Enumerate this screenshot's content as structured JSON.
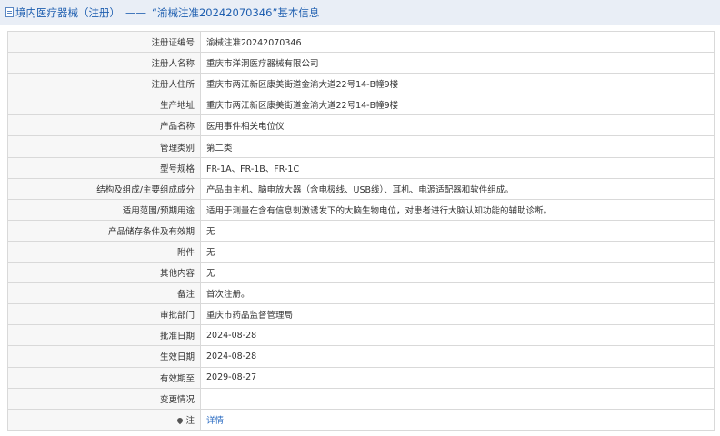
{
  "header": {
    "category_link": "境内医疗器械（注册）",
    "separator": "——",
    "title": "“渝械注准20242070346”基本信息"
  },
  "rows": [
    {
      "label": "注册证编号",
      "value": "渝械注准20242070346"
    },
    {
      "label": "注册人名称",
      "value": "重庆市洋洞医疗器械有限公司"
    },
    {
      "label": "注册人住所",
      "value": "重庆市两江新区康美街道金渝大道22号14-B幢9楼"
    },
    {
      "label": "生产地址",
      "value": "重庆市两江新区康美街道金渝大道22号14-B幢9楼"
    },
    {
      "label": "产品名称",
      "value": "医用事件相关电位仪"
    },
    {
      "label": "管理类别",
      "value": "第二类"
    },
    {
      "label": "型号规格",
      "value": "FR-1A、FR-1B、FR-1C"
    },
    {
      "label": "结构及组成/主要组成成分",
      "value": "产品由主机、脑电放大器（含电极线、USB线）、耳机、电源适配器和软件组成。"
    },
    {
      "label": "适用范围/预期用途",
      "value": "适用于测量在含有信息刺激诱发下的大脑生物电位，对患者进行大脑认知功能的辅助诊断。"
    },
    {
      "label": "产品储存条件及有效期",
      "value": "无"
    },
    {
      "label": "附件",
      "value": "无"
    },
    {
      "label": "其他内容",
      "value": "无"
    },
    {
      "label": "备注",
      "value": "首次注册。"
    },
    {
      "label": "审批部门",
      "value": "重庆市药品监督管理局"
    },
    {
      "label": "批准日期",
      "value": "2024-08-28"
    },
    {
      "label": "生效日期",
      "value": "2024-08-28"
    },
    {
      "label": "有效期至",
      "value": "2029-08-27"
    },
    {
      "label": "变更情况",
      "value": ""
    }
  ],
  "footnote": {
    "label": "注",
    "link": "详情",
    "icon": "pin-icon"
  }
}
